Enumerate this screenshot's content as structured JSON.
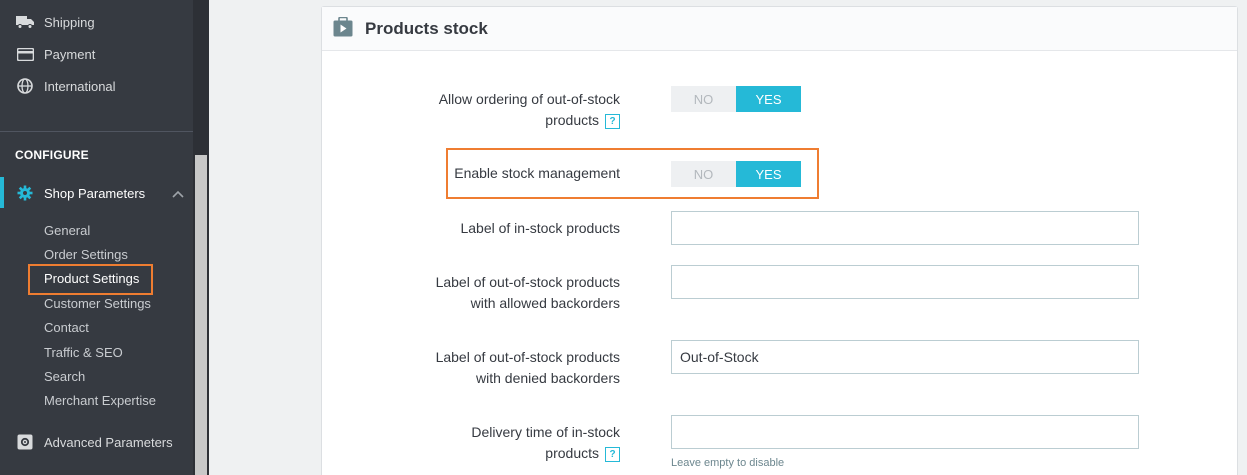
{
  "sidebar": {
    "top_items": [
      {
        "label": "Shipping",
        "icon": "truck-icon"
      },
      {
        "label": "Payment",
        "icon": "credit-card-icon"
      },
      {
        "label": "International",
        "icon": "globe-icon"
      }
    ],
    "section_title": "CONFIGURE",
    "shop_parameters": {
      "label": "Shop Parameters",
      "icon": "gear-icon"
    },
    "sub_items": [
      {
        "label": "General"
      },
      {
        "label": "Order Settings"
      },
      {
        "label": "Product Settings"
      },
      {
        "label": "Customer Settings"
      },
      {
        "label": "Contact"
      },
      {
        "label": "Traffic & SEO"
      },
      {
        "label": "Search"
      },
      {
        "label": "Merchant Expertise"
      }
    ],
    "advanced": {
      "label": "Advanced Parameters",
      "icon": "cog-box-icon"
    }
  },
  "panel": {
    "title": "Products stock",
    "icon": "stock-box-icon",
    "allow_ordering": {
      "label_line1": "Allow ordering of out-of-stock",
      "label_line2": "products",
      "no": "NO",
      "yes": "YES",
      "value": "YES"
    },
    "enable_stock": {
      "label": "Enable stock management",
      "no": "NO",
      "yes": "YES",
      "value": "YES"
    },
    "in_stock_label": {
      "label": "Label of in-stock products",
      "value": ""
    },
    "allowed_backorders": {
      "label_line1": "Label of out-of-stock products",
      "label_line2": "with allowed backorders",
      "value": ""
    },
    "denied_backorders": {
      "label_line1": "Label of out-of-stock products",
      "label_line2": "with denied backorders",
      "value": "Out-of-Stock"
    },
    "delivery_time": {
      "label_line1": "Delivery time of in-stock",
      "label_line2": "products",
      "value": "",
      "hint": "Leave empty to disable"
    },
    "help_glyph": "?"
  },
  "colors": {
    "accent": "#25b9d7",
    "highlight": "#ef7d31",
    "sidebar_bg": "#363a41"
  }
}
